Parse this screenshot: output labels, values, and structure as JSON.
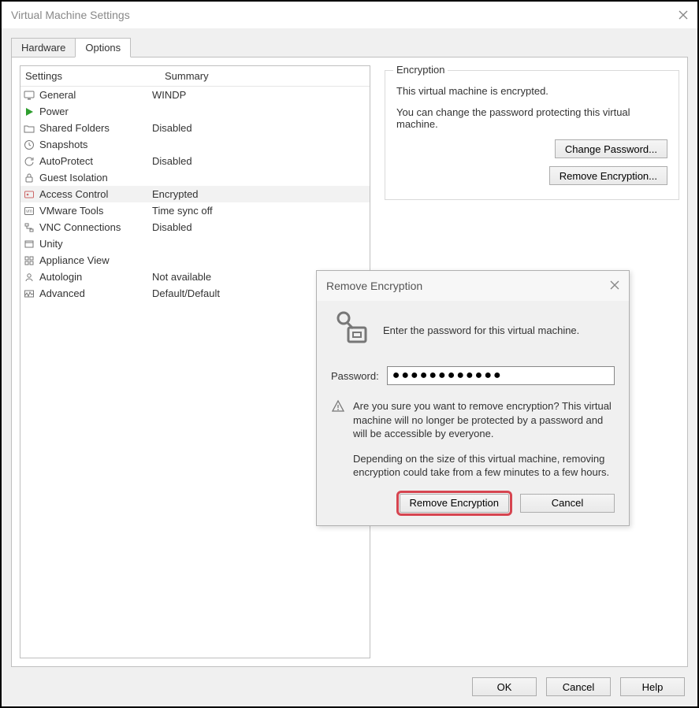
{
  "window": {
    "title": "Virtual Machine Settings"
  },
  "tabs": {
    "hardware": "Hardware",
    "options": "Options"
  },
  "list": {
    "header_settings": "Settings",
    "header_summary": "Summary",
    "items": [
      {
        "name": "General",
        "summary": "WINDP"
      },
      {
        "name": "Power",
        "summary": ""
      },
      {
        "name": "Shared Folders",
        "summary": "Disabled"
      },
      {
        "name": "Snapshots",
        "summary": ""
      },
      {
        "name": "AutoProtect",
        "summary": "Disabled"
      },
      {
        "name": "Guest Isolation",
        "summary": ""
      },
      {
        "name": "Access Control",
        "summary": "Encrypted"
      },
      {
        "name": "VMware Tools",
        "summary": "Time sync off"
      },
      {
        "name": "VNC Connections",
        "summary": "Disabled"
      },
      {
        "name": "Unity",
        "summary": ""
      },
      {
        "name": "Appliance View",
        "summary": ""
      },
      {
        "name": "Autologin",
        "summary": "Not available"
      },
      {
        "name": "Advanced",
        "summary": "Default/Default"
      }
    ]
  },
  "encryption": {
    "legend": "Encryption",
    "line1": "This virtual machine is encrypted.",
    "line2": "You can change the password protecting this virtual machine.",
    "change_btn": "Change Password...",
    "remove_btn": "Remove Encryption..."
  },
  "dialog": {
    "title": "Remove Encryption",
    "prompt": "Enter the password for this virtual machine.",
    "password_label": "Password:",
    "password_value": "●●●●●●●●●●●●",
    "warn1": "Are you sure you want to remove encryption? This virtual machine will no longer be protected by a password and will be accessible by everyone.",
    "warn2": "Depending on the size of this virtual machine, removing encryption could take from a few minutes to a few hours.",
    "remove_btn": "Remove Encryption",
    "cancel_btn": "Cancel"
  },
  "footer": {
    "ok": "OK",
    "cancel": "Cancel",
    "help": "Help"
  }
}
